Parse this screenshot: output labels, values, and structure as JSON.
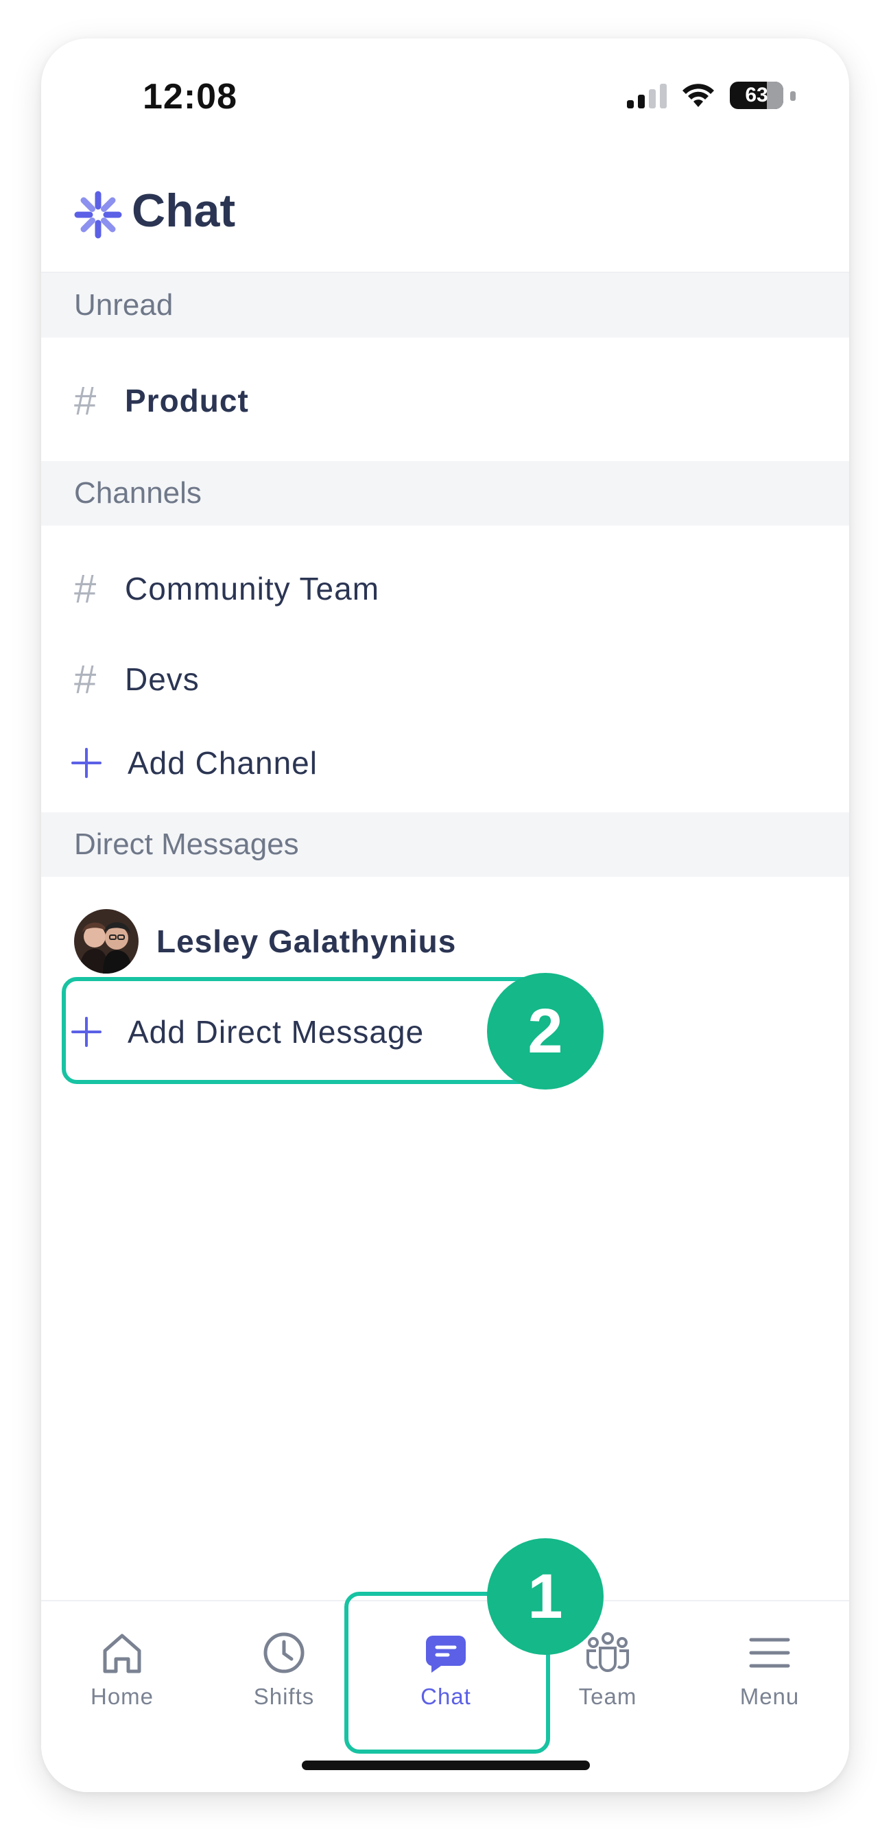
{
  "status_bar": {
    "time": "12:08",
    "battery": "63"
  },
  "header": {
    "title": "Chat",
    "logo_icon": "sunburst-logo-icon"
  },
  "sections": {
    "unread": {
      "title": "Unread",
      "items": [
        {
          "label": "Product"
        }
      ]
    },
    "channels": {
      "title": "Channels",
      "items": [
        {
          "label": "Community Team"
        },
        {
          "label": "Devs"
        }
      ],
      "add_label": "Add Channel"
    },
    "direct_messages": {
      "title": "Direct Messages",
      "items": [
        {
          "name": "Lesley Galathynius"
        }
      ],
      "add_label": "Add Direct Message"
    }
  },
  "annotations": {
    "step1": "1",
    "step2": "2",
    "accent": "#14b889"
  },
  "tabbar": {
    "tabs": [
      {
        "label": "Home",
        "icon": "home-icon"
      },
      {
        "label": "Shifts",
        "icon": "clock-icon"
      },
      {
        "label": "Chat",
        "icon": "chat-bubble-icon",
        "active": true
      },
      {
        "label": "Team",
        "icon": "team-icon"
      },
      {
        "label": "Menu",
        "icon": "hamburger-menu-icon"
      }
    ],
    "active_color": "#5b60e6"
  }
}
